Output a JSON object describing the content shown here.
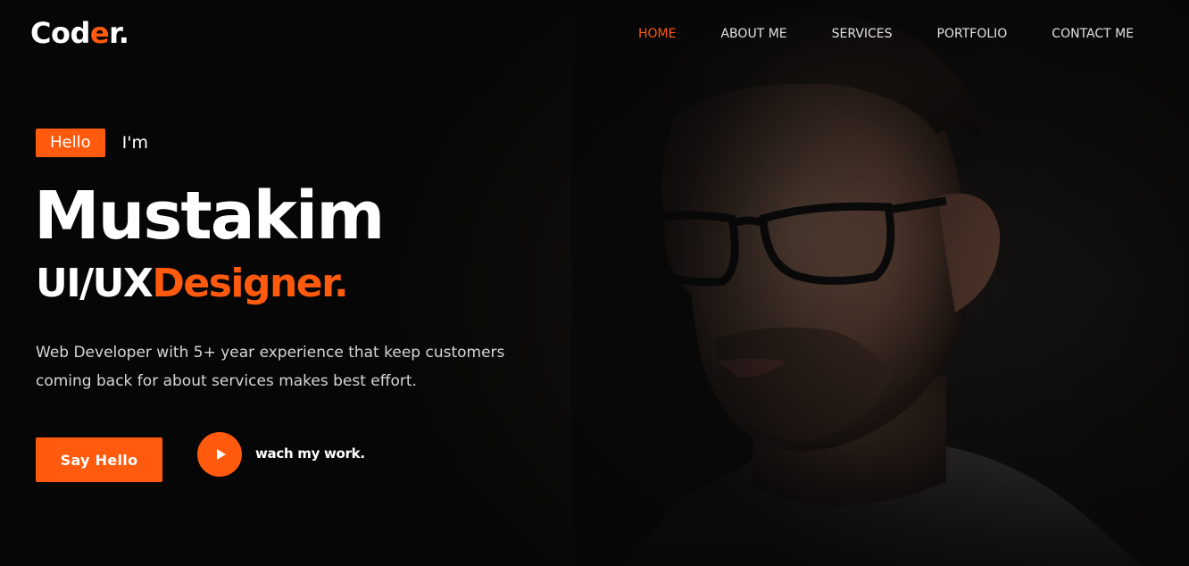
{
  "brand": {
    "logo_prefix": "Cod",
    "logo_accent": "e",
    "logo_suffix": "r."
  },
  "nav": {
    "items": [
      {
        "label": "HOME",
        "active": true
      },
      {
        "label": "ABOUT ME",
        "active": false
      },
      {
        "label": "SERVICES",
        "active": false
      },
      {
        "label": "PORTFOLIO",
        "active": false
      },
      {
        "label": "CONTACT ME",
        "active": false
      }
    ]
  },
  "hero": {
    "badge": "Hello",
    "intro": "I'm",
    "name": "Mustakim",
    "role_prefix": "UI/UX",
    "role_accent": "Designer.",
    "description": "Web Developer with 5+ year experience that keep customers coming back for about services makes best effort.",
    "cta_label": "Say Hello",
    "watch_label": "wach my work."
  },
  "theme": {
    "accent": "#ff5a0d",
    "background": "#070707",
    "text": "#ffffff"
  },
  "icons": {
    "play": "play-icon"
  }
}
